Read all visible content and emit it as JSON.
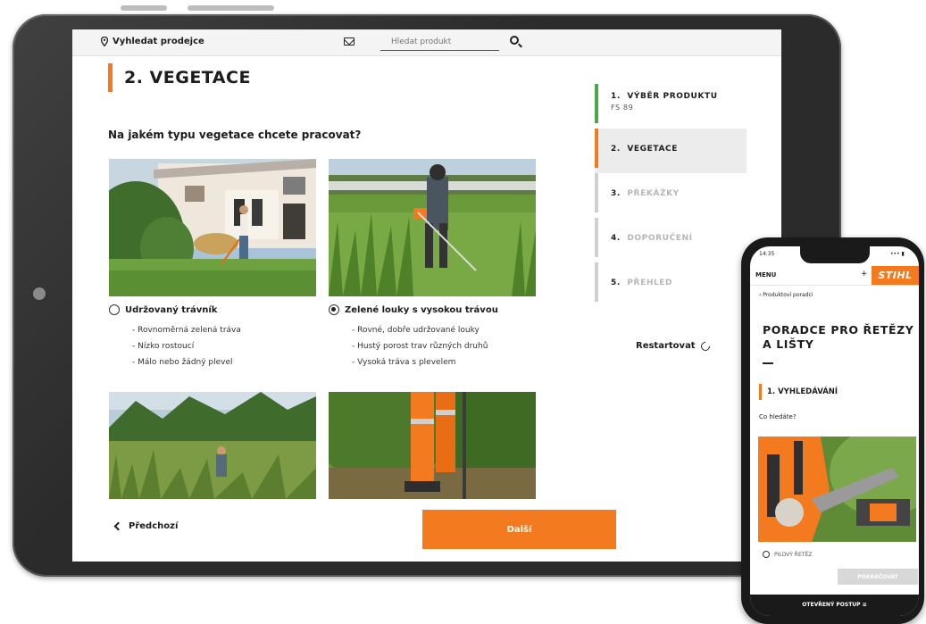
{
  "colors": {
    "accent": "#f37a1f",
    "done_step": "#4aa84a"
  },
  "tablet": {
    "topbar": {
      "dealer_label": "Vyhledat prodejce",
      "search_placeholder": "Hledat produkt",
      "icons": [
        "pin-icon",
        "mail-icon",
        "search-icon"
      ]
    },
    "title": "2. VEGETACE",
    "question": "Na jakém typu vegetace chcete pracovat?",
    "options": [
      {
        "label": "Udržovaný trávník",
        "selected": false,
        "bullets": [
          "Rovnoměrná zelená tráva",
          "Nízko rostoucí",
          "Málo nebo žádný plevel"
        ]
      },
      {
        "label": "Zelené louky s vysokou trávou",
        "selected": true,
        "bullets": [
          "Rovné, dobře udržované louky",
          "Hustý porost trav různých druhů",
          "Vysoká tráva s plevelem"
        ]
      }
    ],
    "steps": [
      {
        "num": "1.",
        "label": "VÝBĚR PRODUKTU",
        "sub": "FS 89",
        "state": "done"
      },
      {
        "num": "2.",
        "label": "VEGETACE",
        "sub": "",
        "state": "active"
      },
      {
        "num": "3.",
        "label": "PŘEKÁŽKY",
        "sub": "",
        "state": "todo"
      },
      {
        "num": "4.",
        "label": "DOPORUČENÍ",
        "sub": "",
        "state": "todo"
      },
      {
        "num": "5.",
        "label": "PŘEHLED",
        "sub": "",
        "state": "todo"
      }
    ],
    "restart_label": "Restartovat",
    "prev_label": "Předchozí",
    "next_label": "Další"
  },
  "phone": {
    "status_time": "14:35",
    "status_right": "••• ▮",
    "menu_label": "MENU",
    "plus": "+",
    "logo": "STIHL",
    "breadcrumb": "‹ Produktoví poradci",
    "title": "PORADCE PRO ŘETĚZY A LIŠTY",
    "step": "1. VYHLEDÁVÁNÍ",
    "question": "Co hledáte?",
    "option": "PILOVÝ ŘETĚZ",
    "button": "POKRAČOVAT",
    "bottom_label": "OTEVŘENÝ POSTUP ≡"
  }
}
